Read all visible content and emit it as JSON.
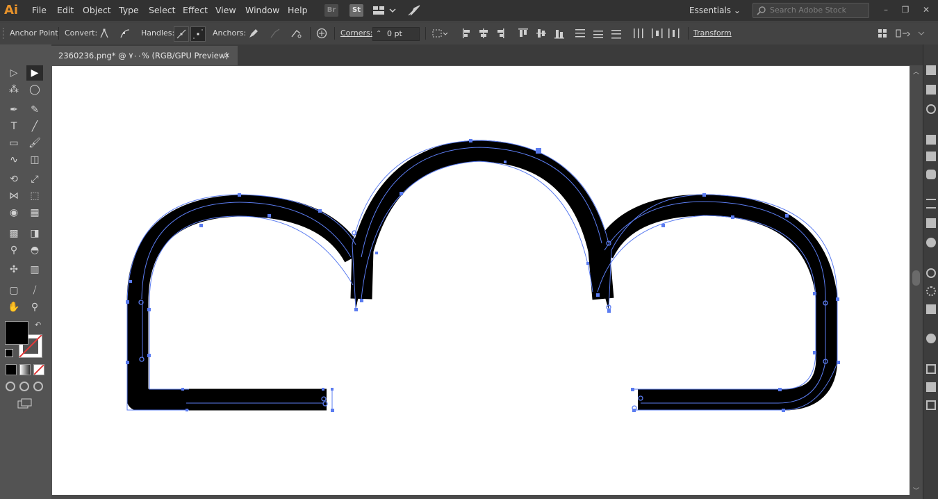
{
  "app": {
    "logo": "Ai",
    "accent": "#e8932b"
  },
  "menu": [
    "File",
    "Edit",
    "Object",
    "Type",
    "Select",
    "Effect",
    "View",
    "Window",
    "Help"
  ],
  "top_badges": {
    "bridge": "Br",
    "stock": "St"
  },
  "workspace": {
    "label": "Essentials"
  },
  "search": {
    "placeholder": "Search Adobe Stock"
  },
  "control_bar": {
    "tool_name": "Anchor Point",
    "convert_label": "Convert:",
    "handles_label": "Handles:",
    "anchors_label": "Anchors:",
    "corners_label": "Corners:",
    "corners_value": "0 pt",
    "transform_label": "Transform"
  },
  "document_tab": {
    "title": "2360236.png* @ ٧٠٠% (RGB/GPU Preview)",
    "close": "×"
  },
  "colors": {
    "path_stroke": "#5b7cf0",
    "fill": "#000000",
    "selected_tool": "#2b2b2b"
  },
  "icons": {
    "tools": [
      "selection-icon",
      "direct-selection-icon",
      "magic-wand-icon",
      "lasso-icon",
      "pen-icon",
      "curvature-icon",
      "type-icon",
      "line-icon",
      "rectangle-icon",
      "paintbrush-icon",
      "shaper-icon",
      "eraser-icon",
      "rotate-icon",
      "scale-icon",
      "width-icon",
      "free-transform-icon",
      "shape-builder-icon",
      "perspective-icon",
      "mesh-icon",
      "gradient-icon",
      "eyedropper-icon",
      "blend-icon",
      "symbol-sprayer-icon",
      "column-graph-icon",
      "artboard-icon",
      "slice-icon",
      "hand-icon",
      "zoom-icon"
    ]
  }
}
